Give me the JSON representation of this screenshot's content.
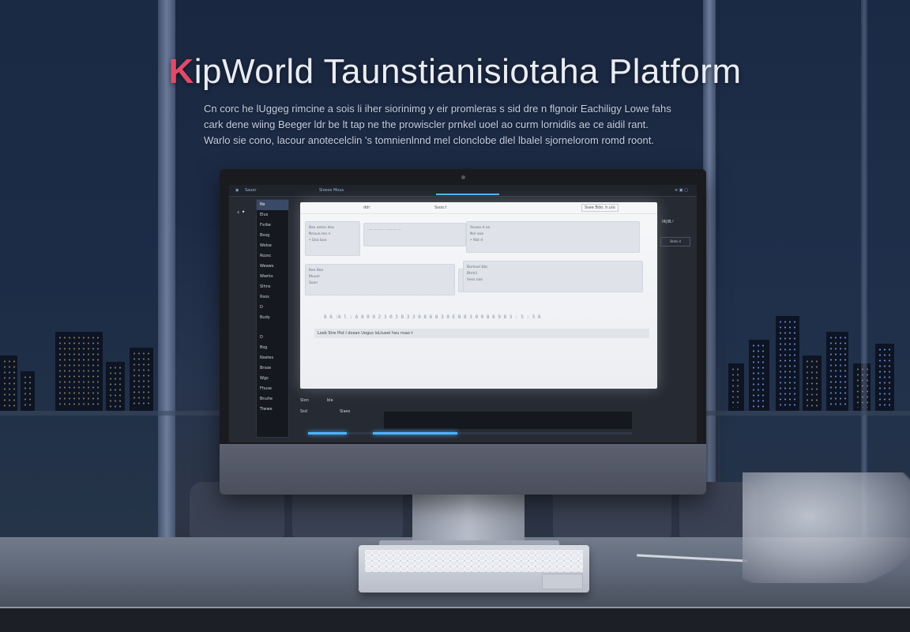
{
  "hero": {
    "logo": "K",
    "title": "ipWorld Taunstianisiotaha Platform",
    "subcopy": [
      "Cn corc he lUggeg rimcine a sois li iher siorinimg y eir promleras s sid dre n flgnoir Eachiligy Lowe fahs",
      "cark dene wiing Beeger ldr be lt tap ne the prowiscler prnkel uoel ao curm lornidils ae ce aidil rant.",
      "Warlo sie cono, lacour anotecelclin 's tomnienlnnd mel clonclobe dlel lbalel sjornelorom romd roont."
    ]
  },
  "screen": {
    "topbar": {
      "left_link": "Sauer",
      "center_link": "Sloeos Mous",
      "right_icons": "≡ ▣ ▢"
    },
    "back_glyph": "‹ •",
    "sidebar": {
      "group1": [
        "Ns",
        "Elus",
        "Fsrbe",
        "Bosg",
        "Wolse",
        "Rozsc",
        "Weaws",
        "Wwrks",
        "Slhns",
        "Rsos",
        "D",
        "Budy"
      ],
      "group2": [
        "D",
        "Bsg",
        "Nsetes",
        "Brsoe",
        "Wgs",
        "Fhuse",
        "Bnuhe",
        "Tiwwe"
      ],
      "active_index": 0
    },
    "panel": {
      "head_left": "ddr",
      "head_center": "Ssoo.t",
      "head_right": "Ssee Bdo. h.ulo",
      "cards": [
        {
          "rows": [
            "Bse ueloo doa",
            "Nnouo mo n",
            "• Dsa boo"
          ]
        },
        {
          "rows": [
            "..... ....... .. ......... ..."
          ]
        },
        {
          "rows": [
            "Ssuws d oo",
            "Nnl ooe",
            "• Rbt d"
          ]
        },
        {
          "rows": [
            "Kee Boo",
            "Muuel",
            "Soon"
          ]
        },
        {
          "rows": [
            "........ ........ ...."
          ]
        },
        {
          "rows": [
            "Borkuel bbc",
            "Bhmil",
            "Sess oao"
          ]
        }
      ],
      "datarow": "8 6 :6 l : 6 8 0 9 2 3 0 3 8 3 3 0 8 6 8 3 0 E 8 8 3 0 0 8 6 9 8 3 : 5 : 5 8",
      "summary": "Lseb Stre Pist l dcean Uogus loLtueel heu nsao t"
    },
    "right_tools": "IR|IB ⁄",
    "right_field": "Bsdo d",
    "bottom": {
      "label_a": "Slon",
      "label_b": "ble",
      "label_c": "Ssd",
      "label_d": "Slaes"
    },
    "progress": [
      0.12,
      0.46
    ]
  }
}
